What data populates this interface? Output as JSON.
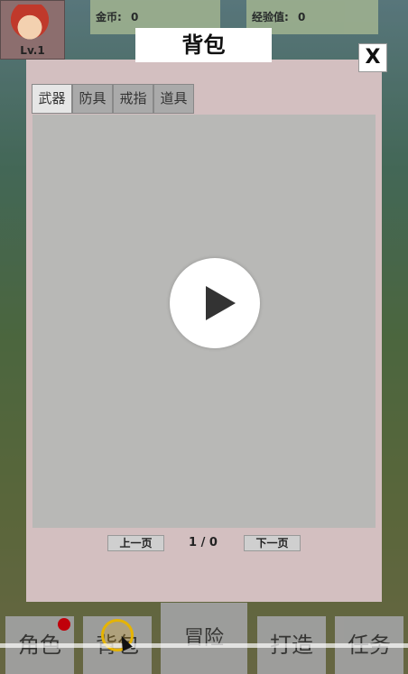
{
  "top_bar": {
    "level": "Lv.1",
    "gold_label": "金币:",
    "gold_value": "0",
    "exp_label": "经验值:",
    "exp_value": "0"
  },
  "dialog": {
    "title": "背包",
    "close_label": "X",
    "tabs": [
      "武器",
      "防具",
      "戒指",
      "道具"
    ],
    "active_tab": "武器",
    "prev_label": "上一页",
    "page_indicator": "1 / 0",
    "next_label": "下一页"
  },
  "bottom_nav": [
    "角色",
    "背包",
    "冒险",
    "打造",
    "任务"
  ]
}
